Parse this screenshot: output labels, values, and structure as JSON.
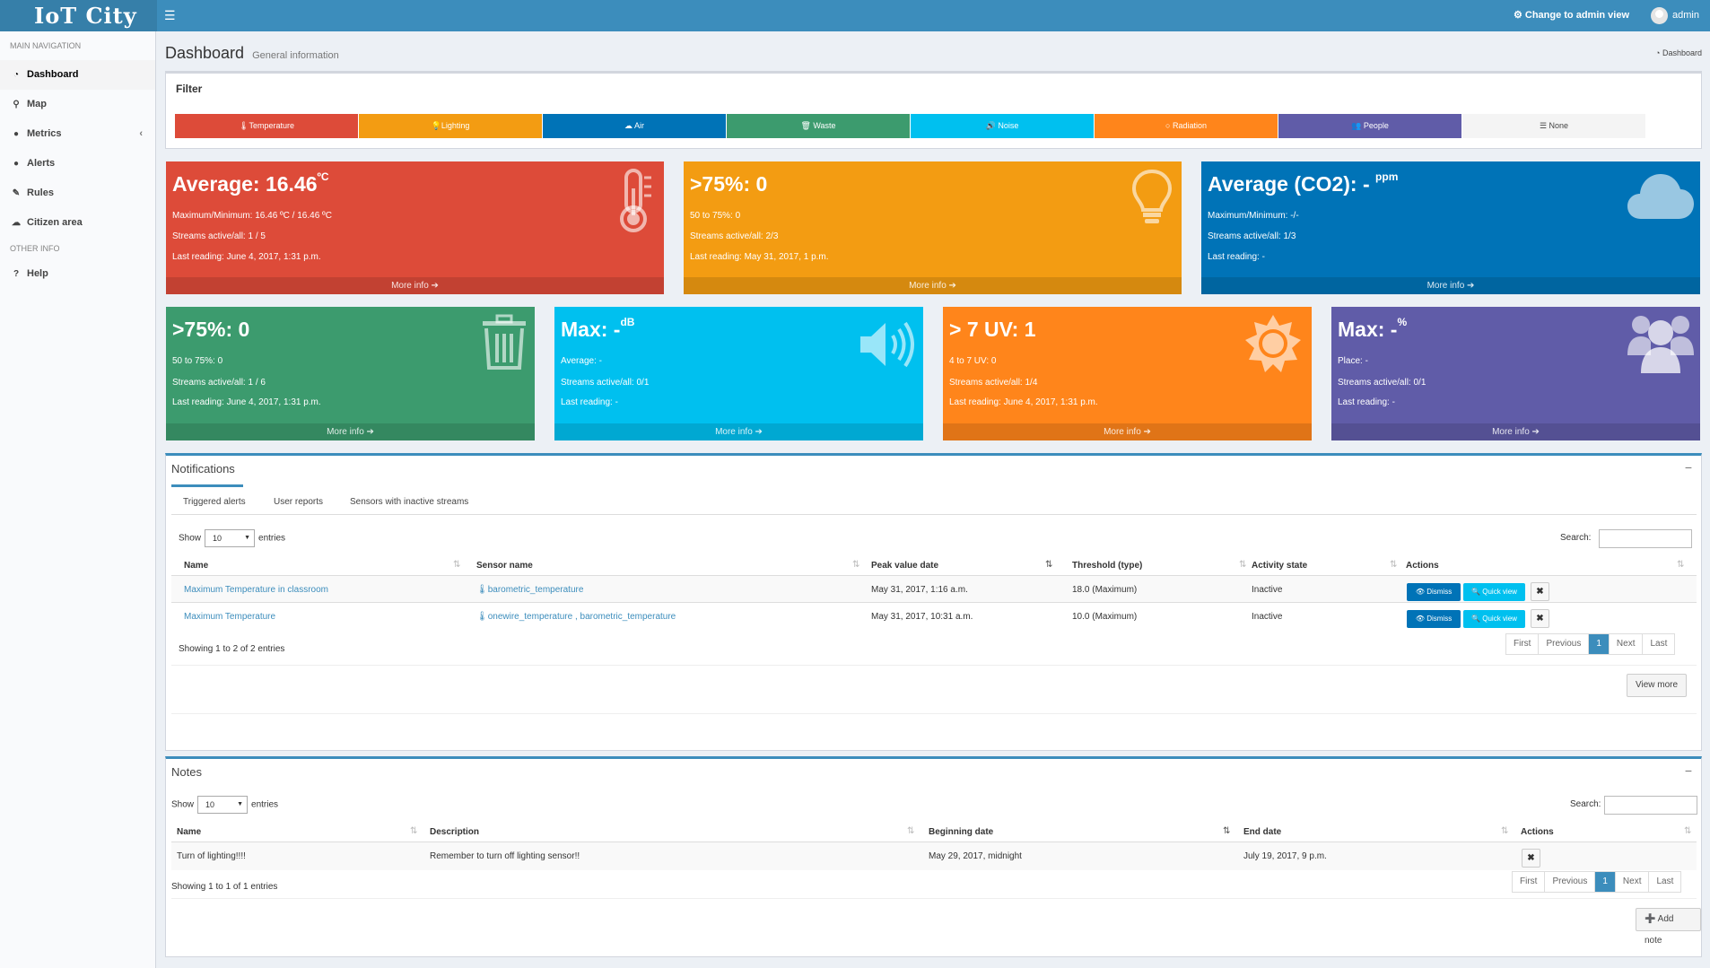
{
  "app": {
    "logo": "IoT City",
    "admin_view": "⚙ Change to admin view",
    "user": "admin"
  },
  "sidebar": {
    "main_header": "MAIN NAVIGATION",
    "items": [
      {
        "label": "Dashboard",
        "icon": "dashboard-icon",
        "glyph": "◔"
      },
      {
        "label": "Map",
        "icon": "map-marker-icon",
        "glyph": "⚲"
      },
      {
        "label": "Metrics",
        "icon": "info-circle-icon",
        "glyph": "●"
      },
      {
        "label": "Alerts",
        "icon": "exclamation-circle-icon",
        "glyph": "●"
      },
      {
        "label": "Rules",
        "icon": "pencil-icon",
        "glyph": "✎"
      },
      {
        "label": "Citizen area",
        "icon": "comments-icon",
        "glyph": "☁"
      }
    ],
    "other_header": "OTHER INFO",
    "help": {
      "label": "Help",
      "icon": "question-circle-icon",
      "glyph": "?"
    }
  },
  "page": {
    "title": "Dashboard",
    "subtitle": "General information",
    "breadcrumb": "◔ Dashboard"
  },
  "filter": {
    "title": "Filter",
    "buttons": [
      {
        "label": "🌡Temperature",
        "color": "#dd4b39"
      },
      {
        "label": "💡Lighting",
        "color": "#f39c12"
      },
      {
        "label": "☁ Air",
        "color": "#0073b7"
      },
      {
        "label": "🗑 Waste",
        "color": "#3c9b6e"
      },
      {
        "label": "🔊 Noise",
        "color": "#00c0ef"
      },
      {
        "label": "○ Radiation",
        "color": "#ff851b"
      },
      {
        "label": "👥 People",
        "color": "#605ca8"
      },
      {
        "label": "☰ None",
        "color": "#f4f4f4"
      }
    ]
  },
  "tiles": {
    "temperature": {
      "title": "Average: 16.46",
      "unit": "ºC",
      "line1": "Maximum/Minimum: 16.46 ºC / 16.46 ºC",
      "line2": "Streams active/all: 1 / 5",
      "line3": "Last reading: June 4, 2017, 1:31 p.m.",
      "more": "More info ➔",
      "color": "#dd4b39"
    },
    "lighting": {
      "title": ">75%: 0",
      "line1": "50 to 75%: 0",
      "line2": "Streams active/all: 2/3",
      "line3": "Last reading: May 31, 2017, 1 p.m.",
      "more": "More info ➔",
      "color": "#f39c12"
    },
    "air": {
      "title": "Average (CO2): -",
      "unit": "ppm",
      "line1": "Maximum/Minimum: -/-",
      "line2": "Streams active/all: 1/3",
      "line3": "Last reading: -",
      "more": "More info ➔",
      "color": "#0073b7"
    },
    "waste": {
      "title": ">75%: 0",
      "line1": "50 to 75%: 0",
      "line2": "Streams active/all: 1 / 6",
      "line3": "Last reading: June 4, 2017, 1:31 p.m.",
      "more": "More info ➔",
      "color": "#3c9b6e"
    },
    "noise": {
      "title": "Max: -",
      "unit": "dB",
      "line1": "Average: -",
      "line2": "Streams active/all: 0/1",
      "line3": "Last reading: -",
      "more": "More info ➔",
      "color": "#00c0ef"
    },
    "radiation": {
      "title": "> 7 UV: 1",
      "line1": "4 to 7 UV: 0",
      "line2": "Streams active/all: 1/4",
      "line3": "Last reading: June 4, 2017, 1:31 p.m.",
      "more": "More info ➔",
      "color": "#ff851b"
    },
    "people": {
      "title": "Max: -",
      "unit": "%",
      "line1": "Place: -",
      "line2": "Streams active/all: 0/1",
      "line3": "Last reading: -",
      "more": "More info ➔",
      "color": "#605ca8"
    }
  },
  "notifications": {
    "title": "Notifications",
    "tabs": [
      "Triggered alerts",
      "User reports",
      "Sensors with inactive streams"
    ],
    "show": "Show",
    "entries_value": "10",
    "entries": "entries",
    "search": "Search:",
    "columns": [
      "Name",
      "Sensor name",
      "Peak value date",
      "Threshold (type)",
      "Activity state",
      "Actions"
    ],
    "rows": [
      {
        "name": "Maximum Temperature in classroom",
        "sensor": "🌡barometric_temperature",
        "date": "May 31, 2017, 1:16 a.m.",
        "threshold": "18.0 (Maximum)",
        "state": "Inactive"
      },
      {
        "name": "Maximum Temperature",
        "sensor": "🌡onewire_temperature , barometric_temperature",
        "date": "May 31, 2017, 10:31 a.m.",
        "threshold": "10.0 (Maximum)",
        "state": "Inactive"
      }
    ],
    "dismiss": "👁 Dismiss",
    "quick_view": "🔍 Quick view",
    "info": "Showing 1 to 2 of 2 entries",
    "pager": [
      "First",
      "Previous",
      "1",
      "Next",
      "Last"
    ],
    "view_more": "View more"
  },
  "notes": {
    "title": "Notes",
    "show": "Show",
    "entries_value": "10",
    "entries": "entries",
    "search": "Search:",
    "columns": [
      "Name",
      "Description",
      "Beginning date",
      "End date",
      "Actions"
    ],
    "rows": [
      {
        "name": "Turn of lighting!!!!",
        "description": "Remember to turn off lighting sensor!!",
        "begin": "May 29, 2017, midnight",
        "end": "July 19, 2017, 9 p.m."
      }
    ],
    "info": "Showing 1 to 1 of 1 entries",
    "pager": [
      "First",
      "Previous",
      "1",
      "Next",
      "Last"
    ],
    "add_note": "➕ Add note"
  }
}
